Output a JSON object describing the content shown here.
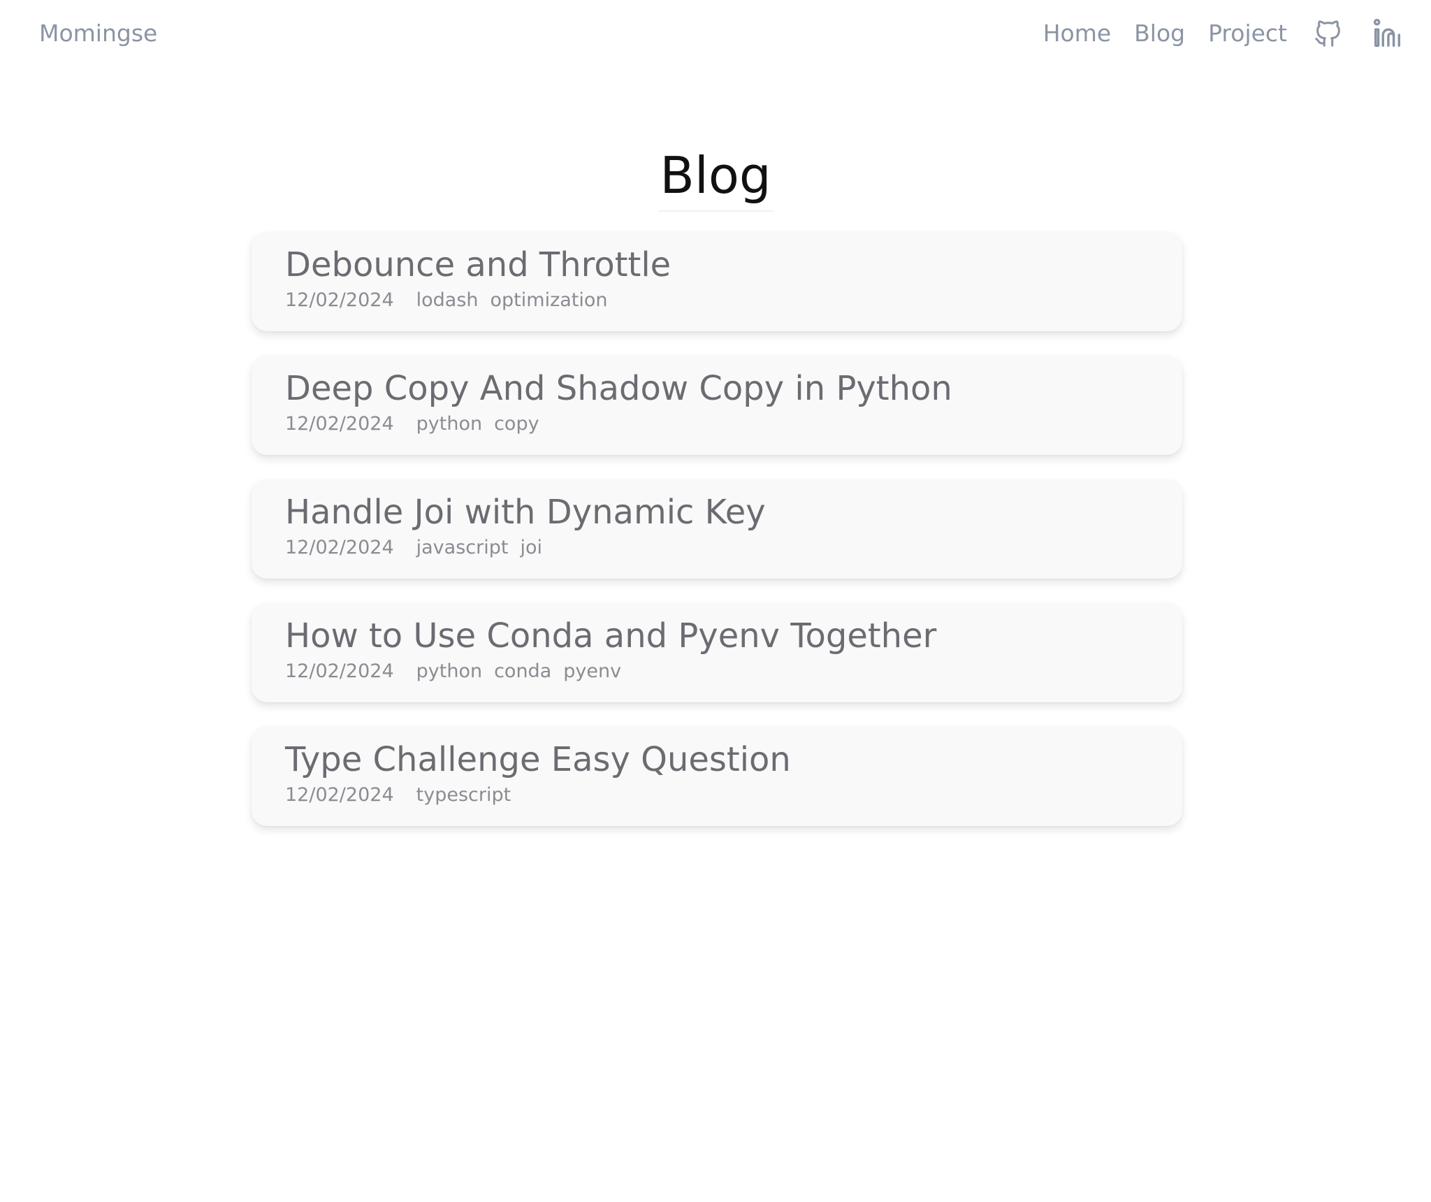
{
  "header": {
    "brand": "Momingse",
    "nav": [
      {
        "label": "Home"
      },
      {
        "label": "Blog"
      },
      {
        "label": "Project"
      }
    ],
    "icons": [
      "github-icon",
      "linkedin-icon"
    ]
  },
  "main": {
    "title": "Blog",
    "posts": [
      {
        "title": "Debounce and Throttle",
        "date": "12/02/2024",
        "tags": [
          "lodash",
          "optimization"
        ]
      },
      {
        "title": "Deep Copy And Shadow Copy in Python",
        "date": "12/02/2024",
        "tags": [
          "python",
          "copy"
        ]
      },
      {
        "title": "Handle Joi with Dynamic Key",
        "date": "12/02/2024",
        "tags": [
          "javascript",
          "joi"
        ]
      },
      {
        "title": "How to Use Conda and Pyenv Together",
        "date": "12/02/2024",
        "tags": [
          "python",
          "conda",
          "pyenv"
        ]
      },
      {
        "title": "Type Challenge Easy Question",
        "date": "12/02/2024",
        "tags": [
          "typescript"
        ]
      }
    ]
  },
  "colors": {
    "nav_text": "#8b94a4",
    "title_text": "#111111",
    "card_bg": "#f9f9f9",
    "post_title": "#6b6b72",
    "meta_text": "#8b8b93"
  }
}
